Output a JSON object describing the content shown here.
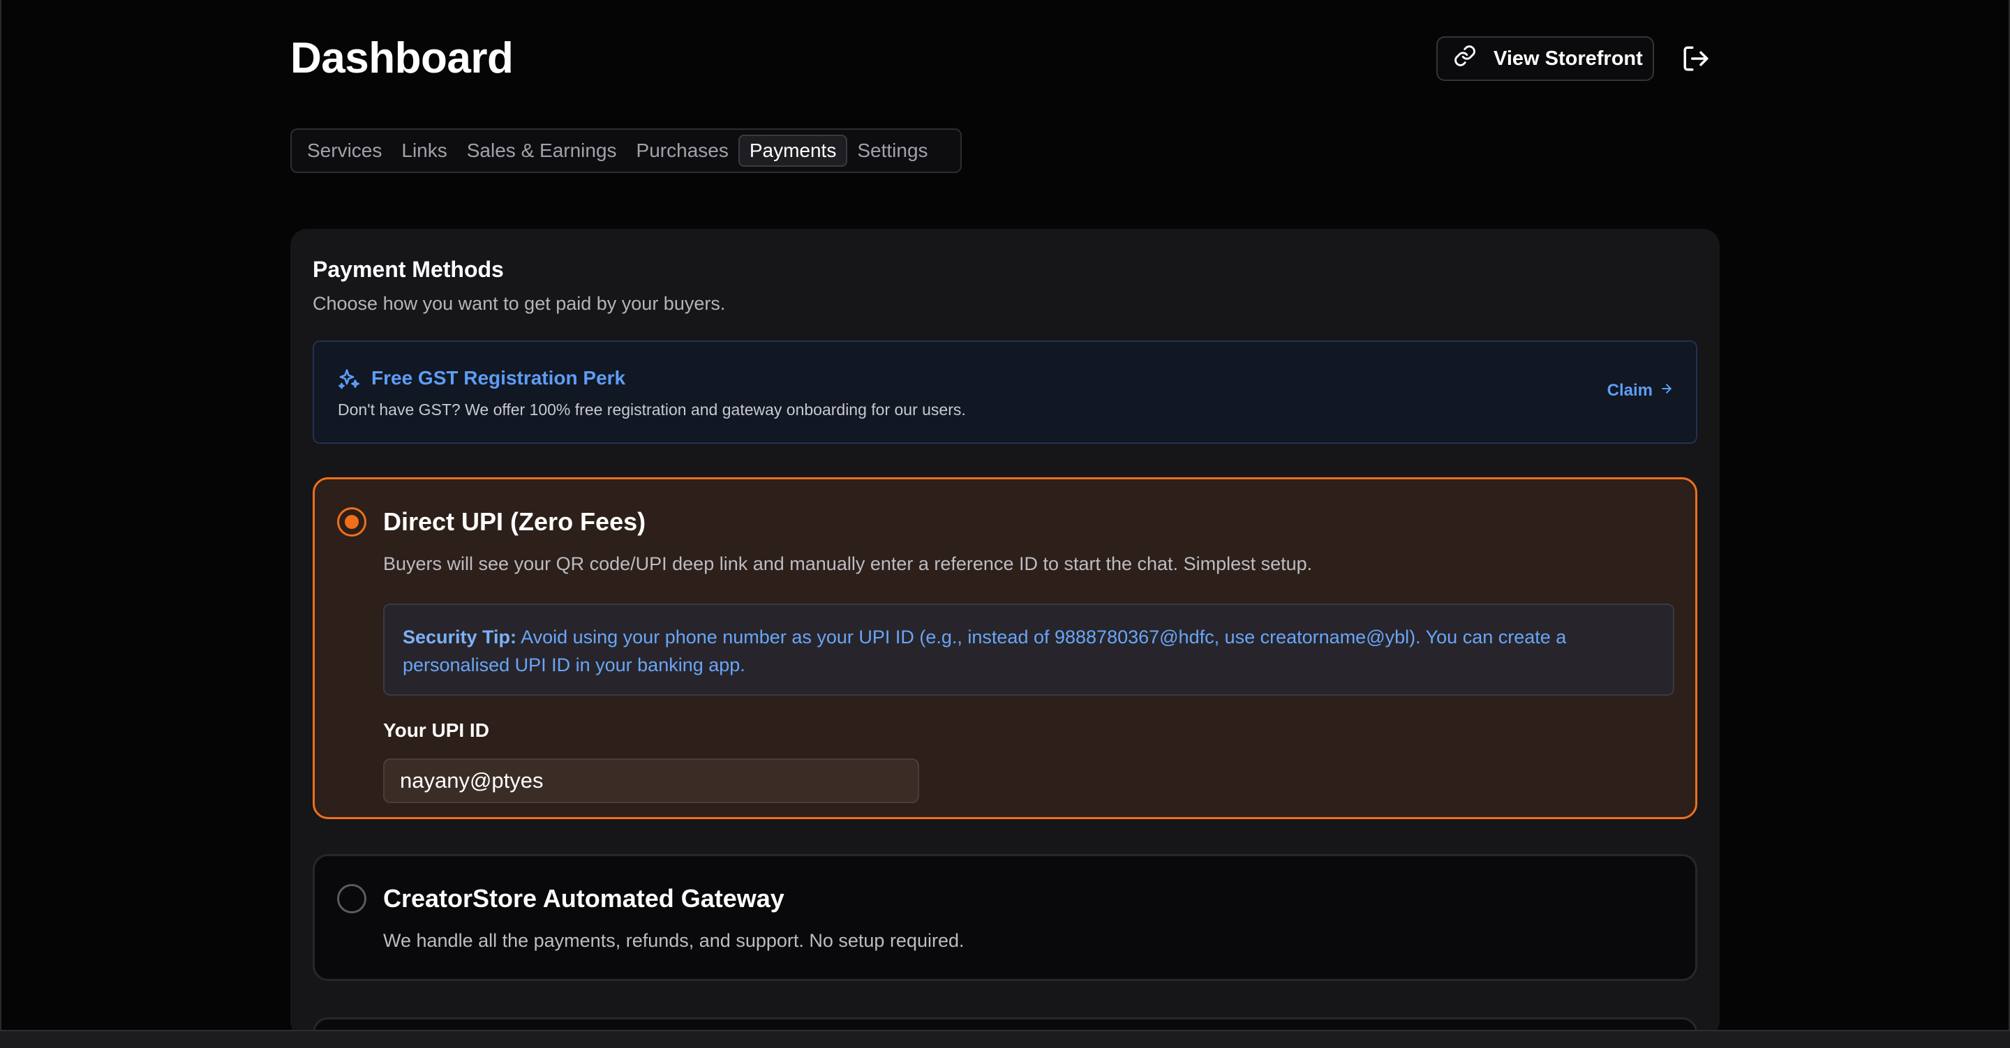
{
  "header": {
    "title": "Dashboard",
    "storefront_label": "View Storefront"
  },
  "tabs": [
    {
      "label": "Services",
      "active": false
    },
    {
      "label": "Links",
      "active": false
    },
    {
      "label": "Sales & Earnings",
      "active": false
    },
    {
      "label": "Purchases",
      "active": false
    },
    {
      "label": "Payments",
      "active": true
    },
    {
      "label": "Settings",
      "active": false
    }
  ],
  "payment_methods": {
    "title": "Payment Methods",
    "subtitle": "Choose how you want to get paid by your buyers.",
    "perk": {
      "title": "Free GST Registration Perk",
      "description": "Don't have GST? We offer 100% free registration and gateway onboarding for our users.",
      "action_label": "Claim"
    },
    "options": [
      {
        "title": "Direct UPI (Zero Fees)",
        "description": "Buyers will see your QR code/UPI deep link and manually enter a reference ID to start the chat. Simplest setup.",
        "selected": true,
        "tip_label": "Security Tip:",
        "tip_text": "Avoid using your phone number as your UPI ID (e.g., instead of 9888780367@hdfc, use creatorname@ybl). You can create a personalised UPI ID in your banking app.",
        "field_label": "Your UPI ID",
        "field_value": "nayany@ptyes"
      },
      {
        "title": "CreatorStore Automated Gateway",
        "description": "We handle all the payments, refunds, and support. No setup required.",
        "selected": false
      }
    ]
  },
  "colors": {
    "accent": "#f06f1c",
    "link": "#5d9df5",
    "background": "#050506",
    "panel": "#161619"
  },
  "icons": {
    "storefront": "link-icon",
    "logout": "logout-icon",
    "perk": "sparkles-icon",
    "claim": "arrow-right-icon"
  }
}
